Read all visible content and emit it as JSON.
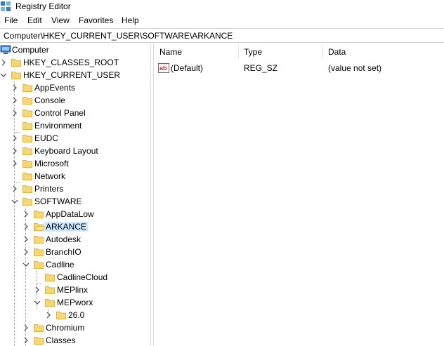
{
  "window": {
    "title": "Registry Editor",
    "icon": "registry-editor-icon"
  },
  "menu": {
    "items": [
      "File",
      "Edit",
      "View",
      "Favorites",
      "Help"
    ]
  },
  "address": {
    "path": "Computer\\HKEY_CURRENT_USER\\SOFTWARE\\ARKANCE"
  },
  "tree": {
    "root": "Computer",
    "nodes": [
      {
        "label": "HKEY_CLASSES_ROOT",
        "level": 1,
        "state": "collapsed"
      },
      {
        "label": "HKEY_CURRENT_USER",
        "level": 1,
        "state": "expanded"
      },
      {
        "label": "AppEvents",
        "level": 2,
        "state": "collapsed"
      },
      {
        "label": "Console",
        "level": 2,
        "state": "collapsed"
      },
      {
        "label": "Control Panel",
        "level": 2,
        "state": "collapsed"
      },
      {
        "label": "Environment",
        "level": 2,
        "state": "leaf"
      },
      {
        "label": "EUDC",
        "level": 2,
        "state": "collapsed"
      },
      {
        "label": "Keyboard Layout",
        "level": 2,
        "state": "collapsed"
      },
      {
        "label": "Microsoft",
        "level": 2,
        "state": "collapsed"
      },
      {
        "label": "Network",
        "level": 2,
        "state": "leaf"
      },
      {
        "label": "Printers",
        "level": 2,
        "state": "collapsed"
      },
      {
        "label": "SOFTWARE",
        "level": 2,
        "state": "expanded"
      },
      {
        "label": "AppDataLow",
        "level": 3,
        "state": "collapsed"
      },
      {
        "label": "ARKANCE",
        "level": 3,
        "state": "collapsed",
        "selected": true
      },
      {
        "label": "Autodesk",
        "level": 3,
        "state": "collapsed"
      },
      {
        "label": "BranchIO",
        "level": 3,
        "state": "collapsed"
      },
      {
        "label": "Cadline",
        "level": 3,
        "state": "expanded"
      },
      {
        "label": "CadlineCloud",
        "level": 4,
        "state": "leaf"
      },
      {
        "label": "MEPlinx",
        "level": 4,
        "state": "collapsed"
      },
      {
        "label": "MEPworx",
        "level": 4,
        "state": "expanded"
      },
      {
        "label": "26.0",
        "level": 5,
        "state": "collapsed"
      },
      {
        "label": "Chromium",
        "level": 3,
        "state": "collapsed"
      },
      {
        "label": "Classes",
        "level": 3,
        "state": "collapsed"
      }
    ]
  },
  "values": {
    "columns": [
      "Name",
      "Type",
      "Data"
    ],
    "rows": [
      {
        "name": "(Default)",
        "type": "REG_SZ",
        "data": "(value not set)",
        "icon": "string-value-icon"
      }
    ]
  },
  "colors": {
    "folder": "#f5d776",
    "folder_edge": "#dcb44a",
    "selection": "#cce8ff"
  }
}
